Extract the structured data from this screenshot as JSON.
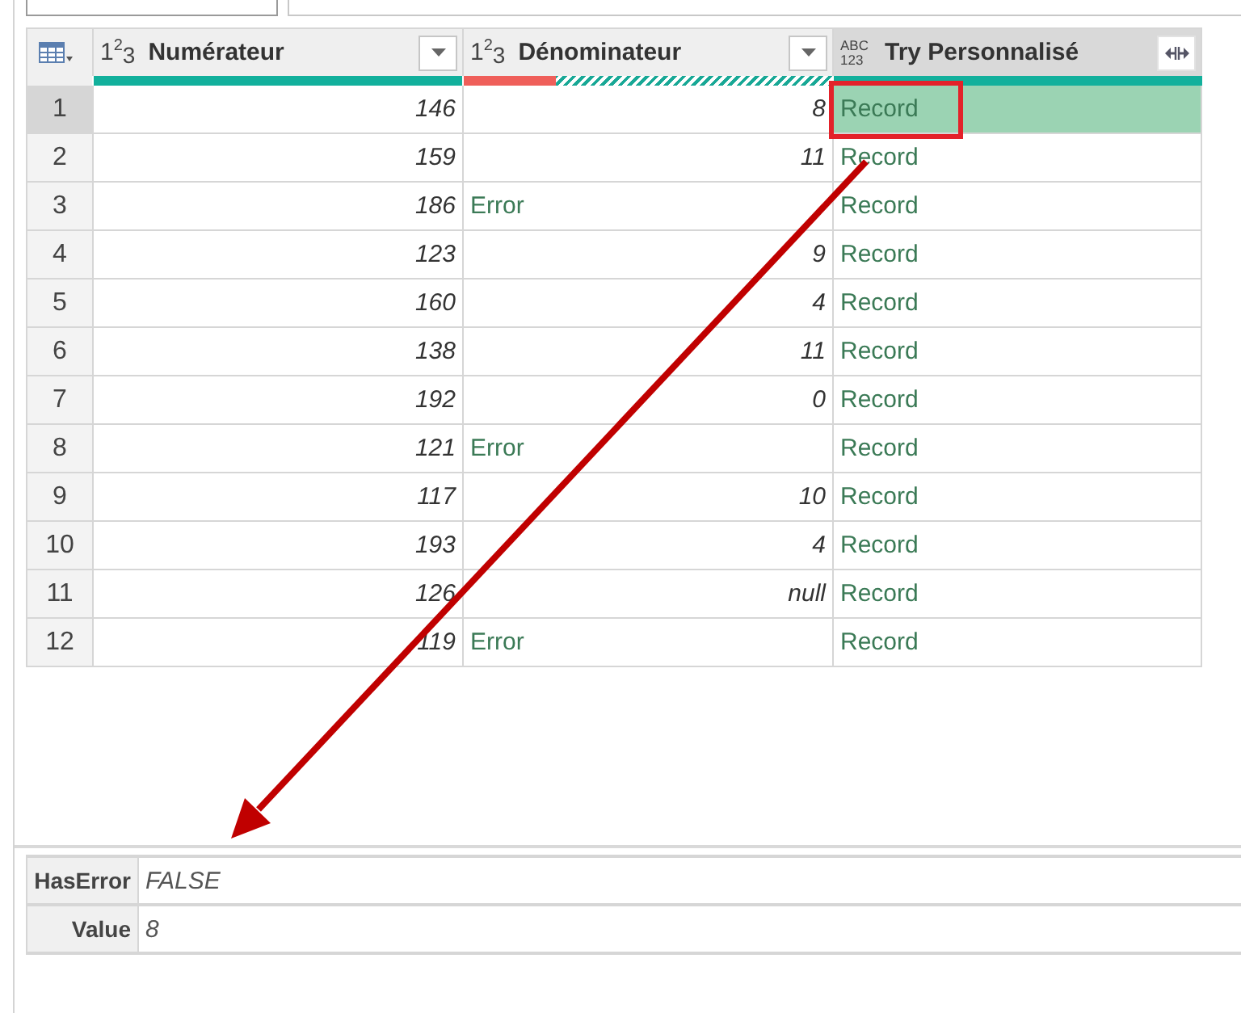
{
  "table": {
    "columns": [
      {
        "type_label": [
          "1$^{2}$$_{3}$"
        ],
        "name": "Numérateur",
        "kind": "filter",
        "selected": false,
        "quality": [
          {
            "kind": "valid",
            "level": 1
          }
        ]
      },
      {
        "type_label": [
          "1$^{2}$$_{3}$"
        ],
        "name": "Dénominateur",
        "kind": "filter",
        "selected": false,
        "quality": [
          {
            "kind": "error",
            "level": 0.25
          },
          {
            "kind": "striped",
            "level": 0.75
          }
        ]
      },
      {
        "type_label": [
          "ABC",
          "123"
        ],
        "name": "Try Personnalisé",
        "kind": "expand",
        "selected": true,
        "quality": [
          {
            "kind": "valid",
            "level": 1
          }
        ]
      }
    ],
    "rows": [
      {
        "number": "1",
        "selected": true,
        "cells": [
          {
            "kind": "number",
            "text": "146"
          },
          {
            "kind": "number",
            "text": "8"
          },
          {
            "kind": "record",
            "text": "Record"
          }
        ]
      },
      {
        "number": "2",
        "selected": false,
        "cells": [
          {
            "kind": "number",
            "text": "159"
          },
          {
            "kind": "number",
            "text": "11"
          },
          {
            "kind": "record",
            "text": "Record"
          }
        ]
      },
      {
        "number": "3",
        "selected": false,
        "cells": [
          {
            "kind": "number",
            "text": "186"
          },
          {
            "kind": "error",
            "text": "Error"
          },
          {
            "kind": "record",
            "text": "Record"
          }
        ]
      },
      {
        "number": "4",
        "selected": false,
        "cells": [
          {
            "kind": "number",
            "text": "123"
          },
          {
            "kind": "number",
            "text": "9"
          },
          {
            "kind": "record",
            "text": "Record"
          }
        ]
      },
      {
        "number": "5",
        "selected": false,
        "cells": [
          {
            "kind": "number",
            "text": "160"
          },
          {
            "kind": "number",
            "text": "4"
          },
          {
            "kind": "record",
            "text": "Record"
          }
        ]
      },
      {
        "number": "6",
        "selected": false,
        "cells": [
          {
            "kind": "number",
            "text": "138"
          },
          {
            "kind": "number",
            "text": "11"
          },
          {
            "kind": "record",
            "text": "Record"
          }
        ]
      },
      {
        "number": "7",
        "selected": false,
        "cells": [
          {
            "kind": "number",
            "text": "192"
          },
          {
            "kind": "number",
            "text": "0"
          },
          {
            "kind": "record",
            "text": "Record"
          }
        ]
      },
      {
        "number": "8",
        "selected": false,
        "cells": [
          {
            "kind": "number",
            "text": "121"
          },
          {
            "kind": "error",
            "text": "Error"
          },
          {
            "kind": "record",
            "text": "Record"
          }
        ]
      },
      {
        "number": "9",
        "selected": false,
        "cells": [
          {
            "kind": "number",
            "text": "117"
          },
          {
            "kind": "number",
            "text": "10"
          },
          {
            "kind": "record",
            "text": "Record"
          }
        ]
      },
      {
        "number": "10",
        "selected": false,
        "cells": [
          {
            "kind": "number",
            "text": "193"
          },
          {
            "kind": "number",
            "text": "4"
          },
          {
            "kind": "record",
            "text": "Record"
          }
        ]
      },
      {
        "number": "11",
        "selected": false,
        "cells": [
          {
            "kind": "number",
            "text": "126"
          },
          {
            "kind": "null",
            "text": "null"
          },
          {
            "kind": "record",
            "text": "Record"
          }
        ]
      },
      {
        "number": "12",
        "selected": false,
        "cells": [
          {
            "kind": "number",
            "text": "119"
          },
          {
            "kind": "error",
            "text": "Error"
          },
          {
            "kind": "record",
            "text": "Record"
          }
        ]
      }
    ]
  },
  "record_fields": [
    {
      "name": "HasError",
      "value": "FALSE"
    },
    {
      "name": "Value",
      "value": "8"
    }
  ]
}
